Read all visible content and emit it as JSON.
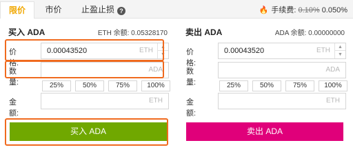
{
  "tabs": [
    {
      "label": "限价"
    },
    {
      "label": "市价"
    },
    {
      "label": "止盈止损"
    }
  ],
  "fee": {
    "label": "手续费:",
    "old": "0.10%",
    "current": "0.050%"
  },
  "buy": {
    "title": "买入 ADA",
    "balance": "ETH 余额: 0.05328170",
    "price": {
      "label": "价格:",
      "value": "0.00043520",
      "unit": "ETH"
    },
    "amount": {
      "label": "数量:",
      "value": "",
      "unit": "ADA"
    },
    "percents": [
      "25%",
      "50%",
      "75%",
      "100%"
    ],
    "total": {
      "label": "金额:",
      "value": "",
      "unit": "ETH"
    },
    "action_label": "买入 ADA"
  },
  "sell": {
    "title": "卖出 ADA",
    "balance": "ADA 余额: 0.00000000",
    "price": {
      "label": "价格:",
      "value": "0.00043520",
      "unit": "ETH"
    },
    "amount": {
      "label": "数量:",
      "value": "",
      "unit": "ADA"
    },
    "percents": [
      "25%",
      "50%",
      "75%",
      "100%"
    ],
    "total": {
      "label": "金额:",
      "value": "",
      "unit": "ETH"
    },
    "action_label": "卖出 ADA"
  },
  "colors": {
    "accent": "#f0a700",
    "buy": "#70a800",
    "sell": "#e0007a",
    "highlight": "#f06a1e"
  }
}
